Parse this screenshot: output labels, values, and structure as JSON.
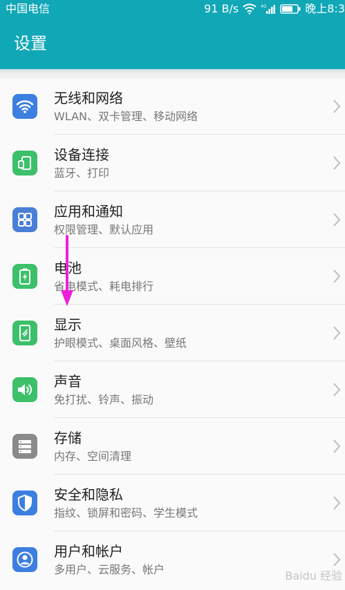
{
  "status_bar": {
    "carrier": "中国电信",
    "speed": "91 B/s",
    "time": "晚上8:3"
  },
  "header": {
    "title": "设置"
  },
  "settings": [
    {
      "title": "无线和网络",
      "subtitle": "WLAN、双卡管理、移动网络",
      "icon": "wifi-icon",
      "color": "#3d7fe0"
    },
    {
      "title": "设备连接",
      "subtitle": "蓝牙、打印",
      "icon": "device-connection-icon",
      "color": "#3cc06a"
    },
    {
      "title": "应用和通知",
      "subtitle": "权限管理、默认应用",
      "icon": "apps-grid-icon",
      "color": "#4a7fd8"
    },
    {
      "title": "电池",
      "subtitle": "省电模式、耗电排行",
      "icon": "battery-icon",
      "color": "#3cc06a"
    },
    {
      "title": "显示",
      "subtitle": "护眼模式、桌面风格、壁纸",
      "icon": "display-icon",
      "color": "#3cc06a"
    },
    {
      "title": "声音",
      "subtitle": "免打扰、铃声、振动",
      "icon": "speaker-icon",
      "color": "#3cc06a"
    },
    {
      "title": "存储",
      "subtitle": "内存、空间清理",
      "icon": "storage-icon",
      "color": "#8a8a8a"
    },
    {
      "title": "安全和隐私",
      "subtitle": "指纹、锁屏和密码、学生模式",
      "icon": "shield-icon",
      "color": "#3d7fe0"
    },
    {
      "title": "用户和帐户",
      "subtitle": "多用户、云服务、帐户",
      "icon": "user-icon",
      "color": "#3d7fe0"
    }
  ],
  "annotation": {
    "arrow_color": "#ee1fd8"
  },
  "watermark": "Baidu 经验"
}
